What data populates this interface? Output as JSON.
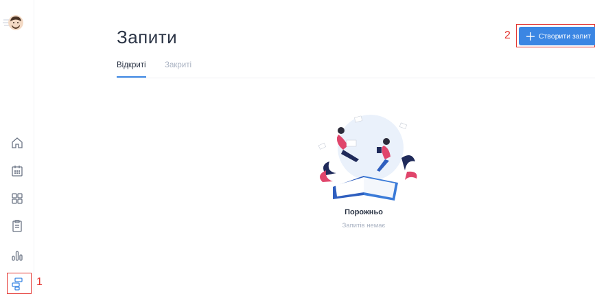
{
  "header": {
    "title": "Запити",
    "create_button_label": "Створити запит"
  },
  "tabs": [
    {
      "label": "Відкриті",
      "active": true
    },
    {
      "label": "Закриті",
      "active": false
    }
  ],
  "empty_state": {
    "title": "Порожньо",
    "subtitle": "Запитів немає"
  },
  "sidebar": {
    "items": [
      {
        "icon": "home-icon"
      },
      {
        "icon": "calendar-icon"
      },
      {
        "icon": "grid-icon"
      },
      {
        "icon": "clipboard-icon"
      },
      {
        "icon": "bar-chart-icon"
      },
      {
        "icon": "requests-icon",
        "active": true
      }
    ]
  },
  "annotations": [
    "1",
    "2"
  ],
  "colors": {
    "accent": "#3b86e3",
    "annotation": "#e3342f",
    "muted": "#a9b2c2"
  }
}
